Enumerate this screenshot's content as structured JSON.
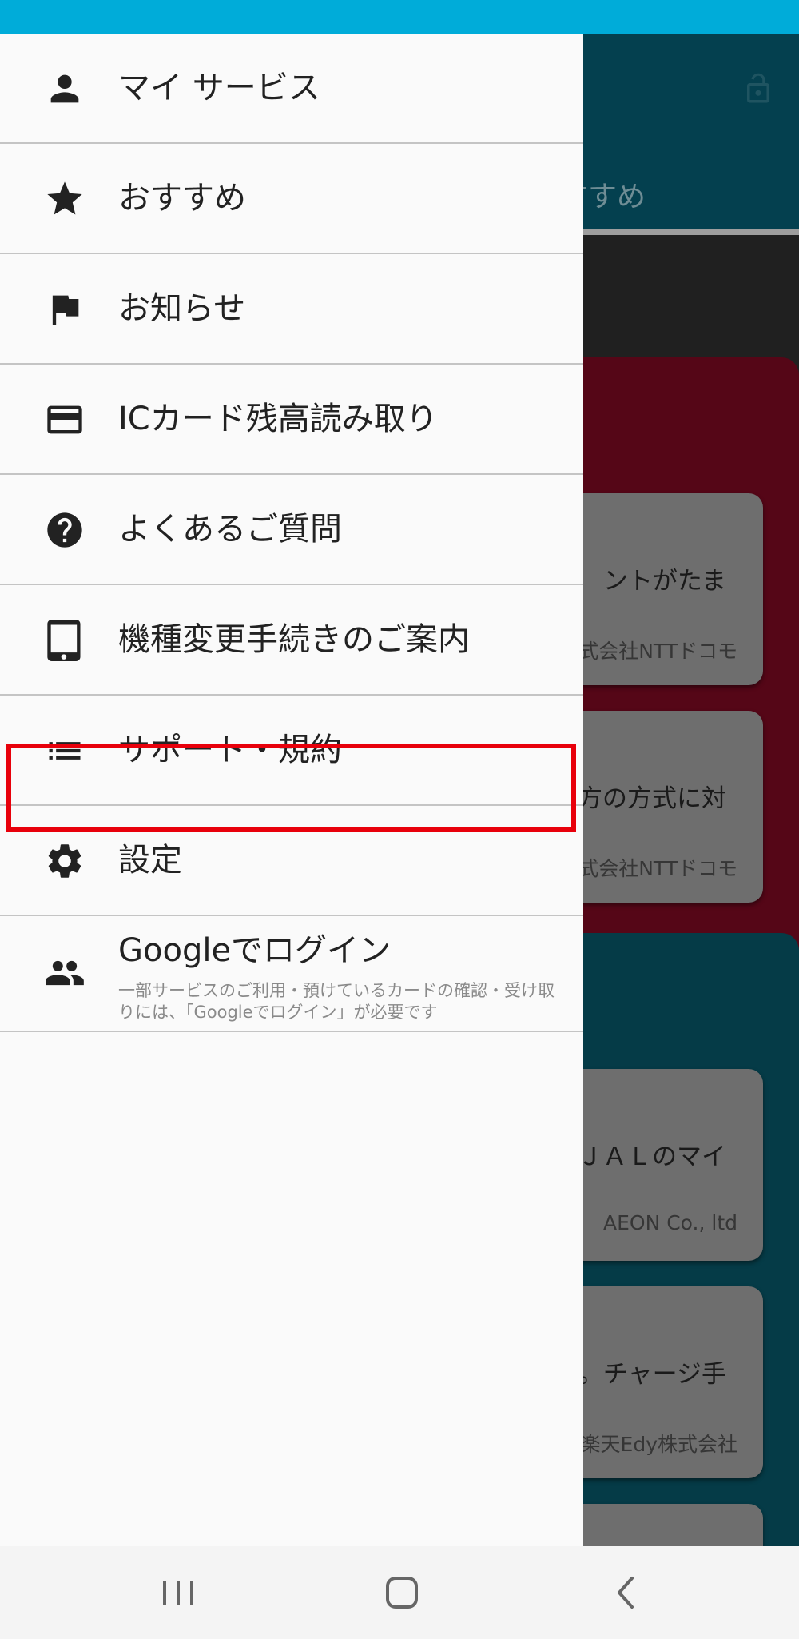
{
  "status_bar": {
    "color": "#00acd9"
  },
  "background_app": {
    "tab_label": "すすめ",
    "cards": [
      {
        "text": "ントがたま",
        "source": "式会社NTTドコモ"
      },
      {
        "text": "方の方式に対",
        "source": "式会社NTTドコモ"
      },
      {
        "text": "ＪＡＬのマイ",
        "source": "AEON Co., ltd"
      },
      {
        "text": "。チャージ手",
        "source": "楽天Edy株式会社"
      }
    ]
  },
  "drawer": {
    "items": [
      {
        "label": "マイ サービス",
        "icon": "person-icon"
      },
      {
        "label": "おすすめ",
        "icon": "star-icon"
      },
      {
        "label": "お知らせ",
        "icon": "flag-icon"
      },
      {
        "label": "ICカード残高読み取り",
        "icon": "credit-card-icon"
      },
      {
        "label": "よくあるご質問",
        "icon": "help-circle-icon"
      },
      {
        "label": "機種変更手続きのご案内",
        "icon": "tablet-icon"
      },
      {
        "label": "サポート・規約",
        "icon": "list-icon",
        "highlighted": true
      },
      {
        "label": "設定",
        "icon": "gear-icon"
      }
    ],
    "login": {
      "label": "Googleでログイン",
      "icon": "people-icon",
      "sub": "一部サービスのご利用・預けているカードの確認・受け取りには、「Googleでログイン」が必要です"
    }
  },
  "highlight_color": "#e8000b",
  "nav_bar": {
    "buttons": [
      "recent-apps-icon",
      "home-icon",
      "back-icon"
    ]
  }
}
